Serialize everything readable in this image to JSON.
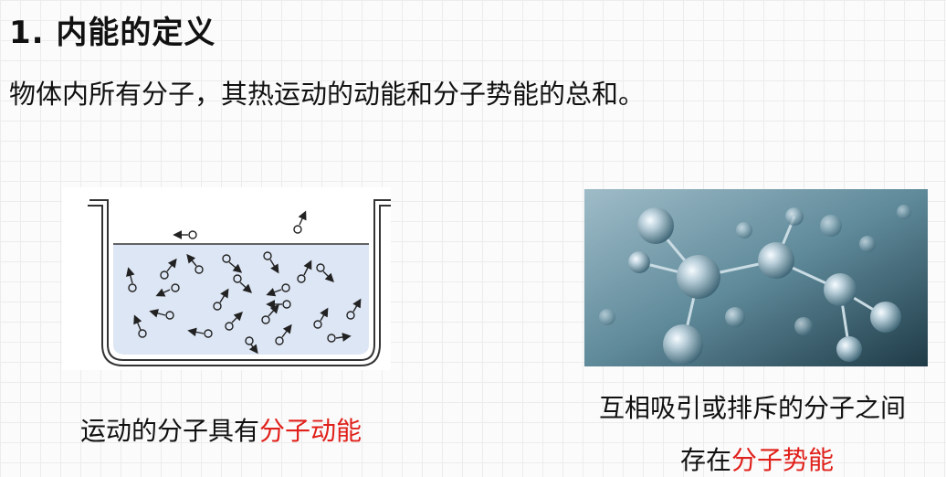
{
  "title": "1. 内能的定义",
  "definition": "物体内所有分子，其热运动的动能和分子势能的总和。",
  "left_figure": {
    "caption_prefix": "运动的分子具有",
    "caption_highlight": "分子动能"
  },
  "right_figure": {
    "caption_line1": "互相吸引或排斥的分子之间",
    "caption_line2_prefix": "存在",
    "caption_line2_highlight": "分子势能"
  },
  "colors": {
    "highlight": "#e0201a",
    "water": "#dfe8f5",
    "molecule_bg": "#5d8797"
  }
}
